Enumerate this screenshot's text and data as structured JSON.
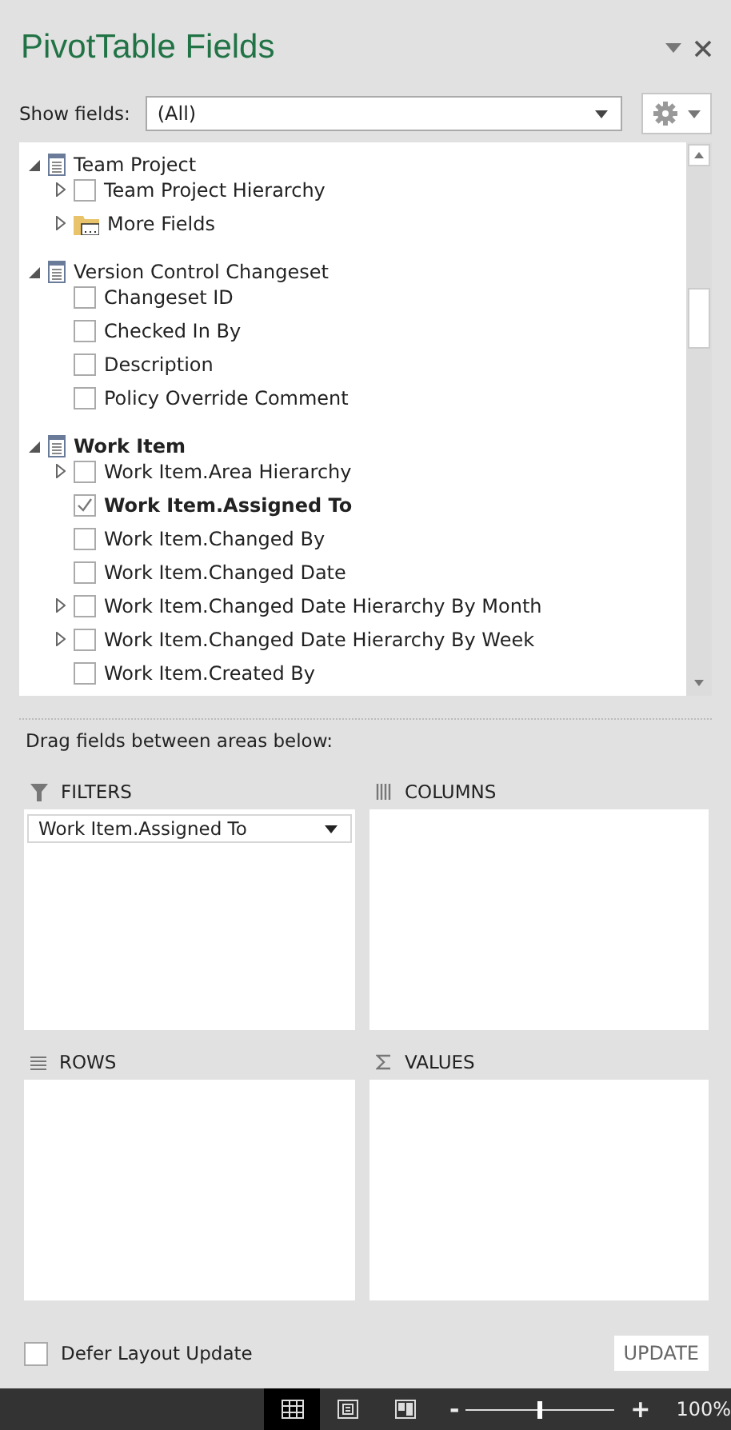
{
  "title": "PivotTable Fields",
  "show_fields": {
    "label": "Show fields:",
    "value": "(All)"
  },
  "field_list": [
    {
      "kind": "table",
      "label": "Team Project",
      "expanded": true,
      "children": [
        {
          "kind": "field",
          "label": "Team Project Hierarchy",
          "checked": false,
          "expandable": true
        },
        {
          "kind": "folder",
          "label": "More Fields",
          "expandable": true
        }
      ]
    },
    {
      "kind": "table",
      "label": "Version Control Changeset",
      "expanded": true,
      "children": [
        {
          "kind": "field",
          "label": "Changeset ID",
          "checked": false,
          "expandable": false
        },
        {
          "kind": "field",
          "label": "Checked In By",
          "checked": false,
          "expandable": false
        },
        {
          "kind": "field",
          "label": "Description",
          "checked": false,
          "expandable": false
        },
        {
          "kind": "field",
          "label": "Policy Override Comment",
          "checked": false,
          "expandable": false
        }
      ]
    },
    {
      "kind": "table",
      "label": "Work Item",
      "expanded": true,
      "children": [
        {
          "kind": "field",
          "label": "Work Item.Area Hierarchy",
          "checked": false,
          "expandable": true
        },
        {
          "kind": "field",
          "label": "Work Item.Assigned To",
          "checked": true,
          "expandable": false
        },
        {
          "kind": "field",
          "label": "Work Item.Changed By",
          "checked": false,
          "expandable": false
        },
        {
          "kind": "field",
          "label": "Work Item.Changed Date",
          "checked": false,
          "expandable": false
        },
        {
          "kind": "field",
          "label": "Work Item.Changed Date Hierarchy By Month",
          "checked": false,
          "expandable": true
        },
        {
          "kind": "field",
          "label": "Work Item.Changed Date Hierarchy By Week",
          "checked": false,
          "expandable": true
        },
        {
          "kind": "field",
          "label": "Work Item.Created By",
          "checked": false,
          "expandable": false
        }
      ]
    }
  ],
  "drag_hint": "Drag fields between areas below:",
  "areas": [
    {
      "kind": "filters",
      "label": "FILTERS",
      "items": [
        "Work Item.Assigned To"
      ]
    },
    {
      "kind": "columns",
      "label": "COLUMNS"
    },
    {
      "kind": "rows",
      "label": "ROWS"
    },
    {
      "kind": "values",
      "label": "VALUES"
    }
  ],
  "defer_layout_update": {
    "label": "Defer Layout Update",
    "checked": false
  },
  "update_button": "UPDATE",
  "status_bar": {
    "views": [
      {
        "kind": "normal",
        "selected": true
      },
      {
        "kind": "page-layout",
        "selected": false
      },
      {
        "kind": "page-break",
        "selected": false
      }
    ],
    "zoom_minus": "-",
    "zoom_plus": "+",
    "zoom": {
      "level": 0.48
    },
    "zoom_text": "100%"
  }
}
